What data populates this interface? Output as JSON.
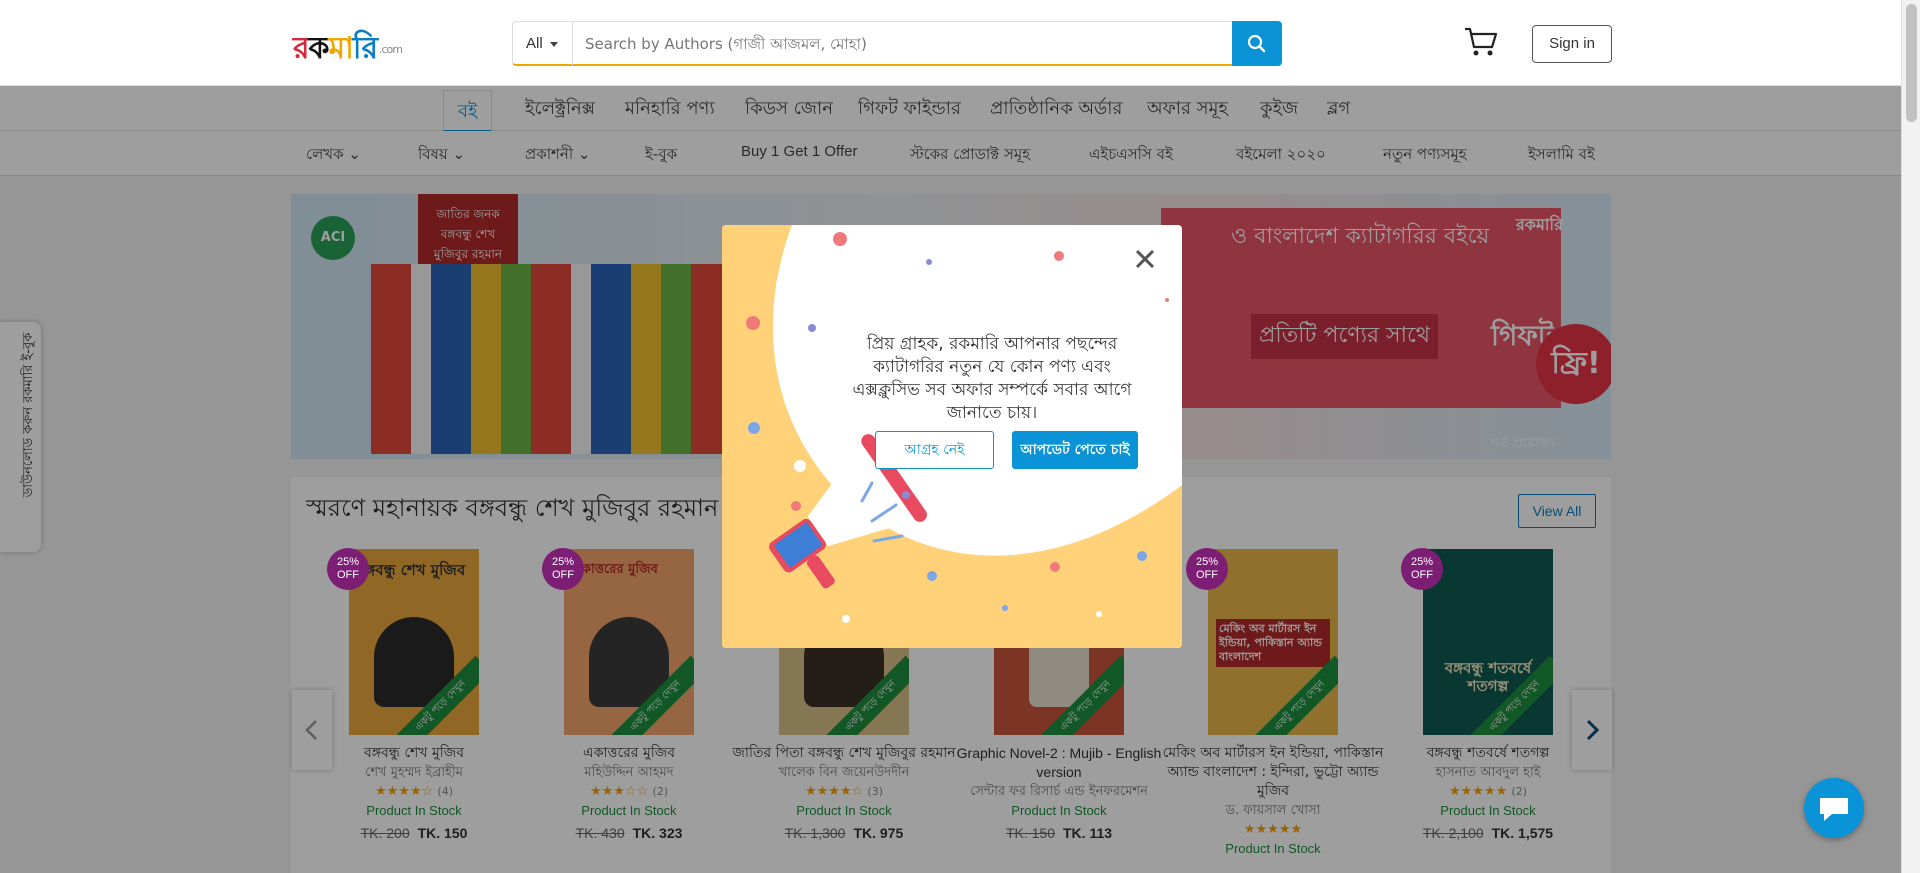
{
  "header": {
    "logo": {
      "part1": "র",
      "part2": "ক",
      "part3": "মা",
      "part4": "রি",
      "suffix": ".com"
    },
    "search": {
      "category": "All",
      "placeholder": "Search by Authors (গাজী আজমল, মোহা)"
    },
    "signin_label": "Sign in"
  },
  "nav_primary": [
    "বই",
    "ইলেক্ট্রনিক্স",
    "মনিহারি পণ্য",
    "কিডস জোন",
    "গিফট ফাইন্ডার",
    "প্রাতিষ্ঠানিক অর্ডার",
    "অফার সমূহ",
    "কুইজ",
    "ব্লগ"
  ],
  "nav_secondary": [
    "লেখক",
    "বিষয়",
    "প্রকাশনী",
    "ই-বুক",
    "Buy 1 Get 1 Offer",
    "স্টকের প্রোডাক্ট সমূহ",
    "এইচএসসি বই",
    "বইমেলা ২০২০",
    "নতুন পণ্যসমূহ",
    "ইসলামি বই"
  ],
  "banner": {
    "brand": "ACI",
    "book_text": "জাতির জনক বঙ্গবন্ধু শেখ মুজিবুর রহমান",
    "headline": "ও বাংলাদেশ ক্যাটাগরির বইয়ে",
    "offer": "প্রতিটি পণ্যের সাথে",
    "offer_gift": "গিফট",
    "free": "ফ্রি!",
    "terms": "শর্ত প্রযোজ্য",
    "logo": "রকমারি"
  },
  "sidetab_label": "ডাউনলোড করুন রকমারি ই-বুক",
  "section": {
    "title": "স্মরণে মহানায়ক বঙ্গবন্ধু শেখ মুজিবুর রহমান",
    "view_all": "View All"
  },
  "products": [
    {
      "badge": "25% OFF",
      "cover_title": "বঙ্গবন্ধু শেখ মুজিব",
      "name": "বঙ্গবন্ধু শেখ মুজিব",
      "author": "শেখ মুহম্মদ ইব্রাহীম",
      "stars": "★★★★☆",
      "reviews": "(4)",
      "stock": "Product In Stock",
      "old_price": "TK. 200",
      "price": "TK. 150"
    },
    {
      "badge": "25% OFF",
      "cover_title": "একাত্তরের মুজিব",
      "name": "একাত্তরের মুজিব",
      "author": "মহিউদ্দিন আহমদ",
      "stars": "★★★☆☆",
      "reviews": "(2)",
      "stock": "Product In Stock",
      "old_price": "TK. 430",
      "price": "TK. 323"
    },
    {
      "badge": "",
      "cover_title": "",
      "name": "জাতির পিতা বঙ্গবন্ধু শেখ মুজিবুর রহমান",
      "author": "খালেক বিন জয়েনউদদীন",
      "stars": "★★★★☆",
      "reviews": "(3)",
      "stock": "Product In Stock",
      "old_price": "TK. 1,300",
      "price": "TK. 975"
    },
    {
      "badge": "",
      "cover_title": "",
      "name": "Graphic Novel-2 : Mujib - English version",
      "author": "সেন্টার ফর রিসার্চ এন্ড ইনফরমেশন",
      "stars": "",
      "reviews": "",
      "stock": "Product In Stock",
      "old_price": "TK. 150",
      "price": "TK. 113"
    },
    {
      "badge": "25% OFF",
      "cover_title": "মেকিং অব মার্টারস ইন ইন্ডিয়া, পাকিস্তান অ্যান্ড বাংলাদেশ",
      "name": "মেকিং অব মার্টারস ইন ইন্ডিয়া, পাকিস্তান অ্যান্ড বাংলাদেশ : ইন্দিরা, ভুট্টো অ্যান্ড মুজিব",
      "author": "ড. ফায়সাল খোসা",
      "stars": "★★★★★",
      "reviews": "",
      "stock": "Product In Stock",
      "old_price": "",
      "price": ""
    },
    {
      "badge": "25% OFF",
      "cover_title": "বঙ্গবন্ধু শতবর্ষে শতগল্প",
      "name": "বঙ্গবন্ধু শতবর্ষে শতগল্প",
      "author": "হাসনাত আবদুল হাই",
      "stars": "★★★★★",
      "reviews": "(2)",
      "stock": "Product In Stock",
      "old_price": "TK. 2,100",
      "price": "TK. 1,575"
    }
  ],
  "modal": {
    "message": "প্রিয় গ্রাহক, রকমারি আপনার পছন্দের ক্যাটাগরির নতুন যে কোন পণ্য এবং এক্সক্লুসিভ সব অফার সম্পর্কে সবার আগে জানাতে চায়।",
    "decline_label": "আগ্রহ নেই",
    "accept_label": "আপডেট পেতে চাই"
  },
  "icons": {
    "search": "search-icon",
    "cart": "cart-icon",
    "close": "close-icon",
    "chat": "chat-icon",
    "megaphone": "megaphone-icon",
    "prev": "chevron-left-icon",
    "next": "chevron-right-icon"
  },
  "colors": {
    "accent": "#0a93d6",
    "underline": "#f0a500",
    "stock": "#1e8e3e",
    "badge": "#7c1e74"
  }
}
